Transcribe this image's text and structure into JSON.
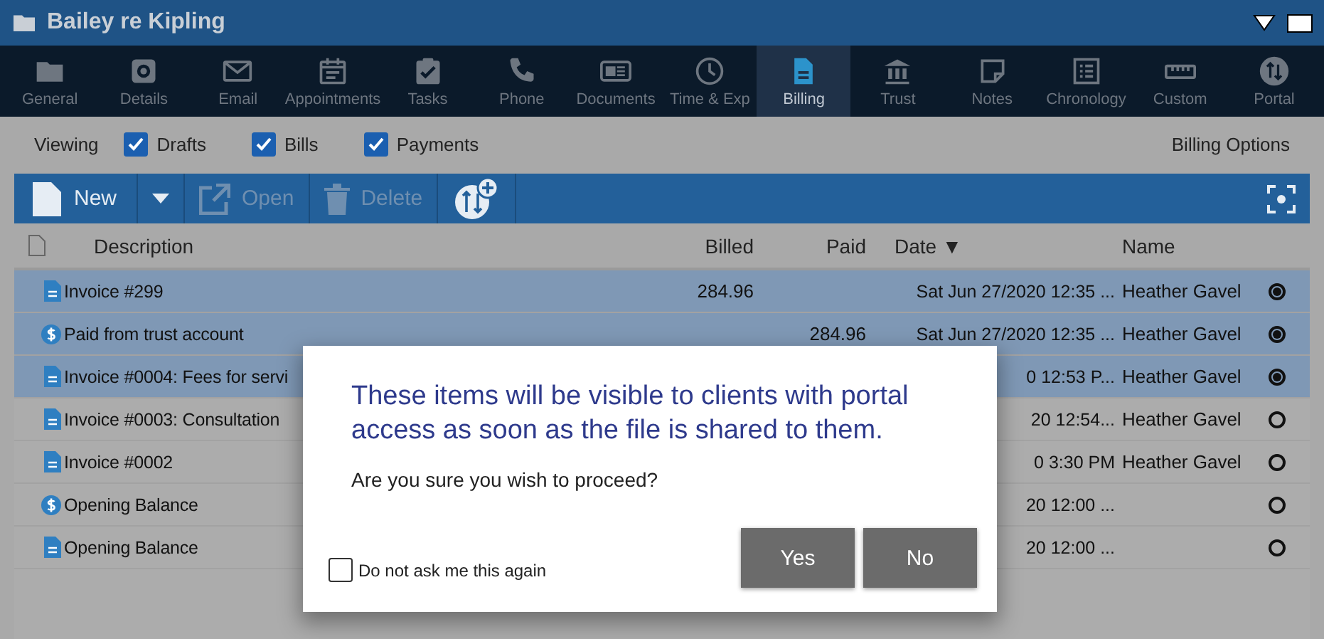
{
  "window": {
    "title": "Bailey re Kipling"
  },
  "nav": [
    {
      "label": "General",
      "selected": false
    },
    {
      "label": "Details",
      "selected": false
    },
    {
      "label": "Email",
      "selected": false
    },
    {
      "label": "Appointments",
      "selected": false
    },
    {
      "label": "Tasks",
      "selected": false
    },
    {
      "label": "Phone",
      "selected": false
    },
    {
      "label": "Documents",
      "selected": false
    },
    {
      "label": "Time & Exp",
      "selected": false
    },
    {
      "label": "Billing",
      "selected": true
    },
    {
      "label": "Trust",
      "selected": false
    },
    {
      "label": "Notes",
      "selected": false
    },
    {
      "label": "Chronology",
      "selected": false
    },
    {
      "label": "Custom",
      "selected": false
    },
    {
      "label": "Portal",
      "selected": false
    }
  ],
  "viewing": {
    "label": "Viewing",
    "filters": [
      {
        "label": "Drafts",
        "checked": true
      },
      {
        "label": "Bills",
        "checked": true
      },
      {
        "label": "Payments",
        "checked": true
      }
    ],
    "options": "Billing Options"
  },
  "toolbar": {
    "buttons": [
      {
        "label": "New",
        "disabled": false
      },
      {
        "label": "Open",
        "disabled": true
      },
      {
        "label": "Delete",
        "disabled": true
      }
    ]
  },
  "table": {
    "columns": [
      "Description",
      "Billed",
      "Paid",
      "Date ▼",
      "Name"
    ],
    "rows": [
      {
        "kind": "document",
        "description": "Invoice #299",
        "billed": "284.96",
        "date": "Sat Jun 27/2020 12:35 ...",
        "name": "Heather Gavel",
        "selected": true
      },
      {
        "kind": "payment",
        "description": "Paid from trust account",
        "paid": "284.96",
        "date": "Sat Jun 27/2020 12:35 ...",
        "name": "Heather Gavel",
        "selected": true
      },
      {
        "kind": "document",
        "description": "Invoice #0004: Fees for servi",
        "date": "0 12:53 P...",
        "name": "Heather Gavel",
        "selected": true
      },
      {
        "kind": "document",
        "description": "Invoice #0003: Consultation",
        "date": "20 12:54...",
        "name": "Heather Gavel",
        "selected": false
      },
      {
        "kind": "document",
        "description": "Invoice #0002",
        "date": "0 3:30 PM",
        "name": "Heather Gavel",
        "selected": false
      },
      {
        "kind": "payment",
        "description": "Opening Balance",
        "date": "20 12:00 ...",
        "selected": false
      },
      {
        "kind": "document",
        "description": "Opening Balance",
        "date": "20 12:00 ...",
        "selected": false
      }
    ]
  },
  "dialog": {
    "title": "These items will be visible to clients with portal access as soon as the file is shared to them.",
    "message": "Are you sure you wish to proceed?",
    "dont_ask": {
      "label": "Do not ask me this again",
      "checked": false
    },
    "buttons": [
      "Yes",
      "No"
    ]
  }
}
